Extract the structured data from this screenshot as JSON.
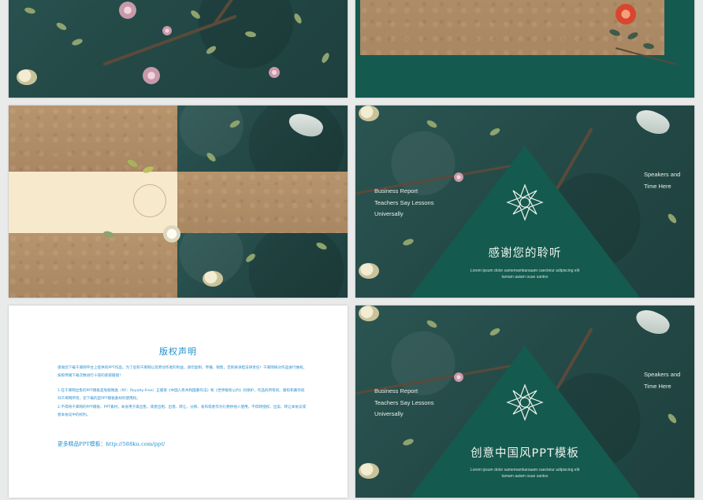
{
  "slides": {
    "s1": {},
    "s2": {},
    "s3": {},
    "s4": {
      "left_lines": [
        "Business Report",
        "Teachers Say Lessons",
        "Universally"
      ],
      "right_lines": [
        "Speakers and",
        "Time Here"
      ],
      "title": "感谢您的聆听",
      "subtitle_1": "Lorem ipsum dolor samemamkarsaam caecteiur adipiscing elit",
      "subtitle_2": "tamam aaiam ouue santox"
    },
    "s5": {
      "title": "版权声明",
      "para1": "感谢您下载千库网平台上提供的PPT作品，为了您和千库网以及原创作者的利益，请勿复制、传播、销售，否则将承担法律责任！千库网将对作品进行维权，按照传播下载次数进行十倍的索取赔偿！",
      "para2": "1.在千库网出售的PPT模板是免版税类（RF：Royalty-Free）正版受《中国人民共和国著作法》和《世界版权公约》的保护，作品的所有权、版权和著作权归千库网所有，您下载的是PPT模板素材的使用权。",
      "para3": "2.不得将千库网的PPT模板、PPT素材，本身用于再出售，或者出租、出借、转让、分销、发布或者作为礼物供他人使用，不得转授权、出卖、转让本协议或者本协议中的权利。",
      "link": "更多精品PPT模板：http://588ku.com/ppt/"
    },
    "s6": {
      "left_lines": [
        "Business Report",
        "Teachers Say Lessons",
        "Universally"
      ],
      "right_lines": [
        "Speakers and",
        "Time Here"
      ],
      "title": "创意中国风PPT模板",
      "subtitle_1": "Lorem ipsum dolor samemamkarsaam caecteiur adipiscing elit",
      "subtitle_2": "tamam aaiam ouue santox"
    }
  },
  "colors": {
    "teal_dark": "#244a48",
    "triangle": "#155a4f",
    "kraft": "#b7946c",
    "cream": "#f7e9cc",
    "doc_blue": "#1f8fd0"
  }
}
